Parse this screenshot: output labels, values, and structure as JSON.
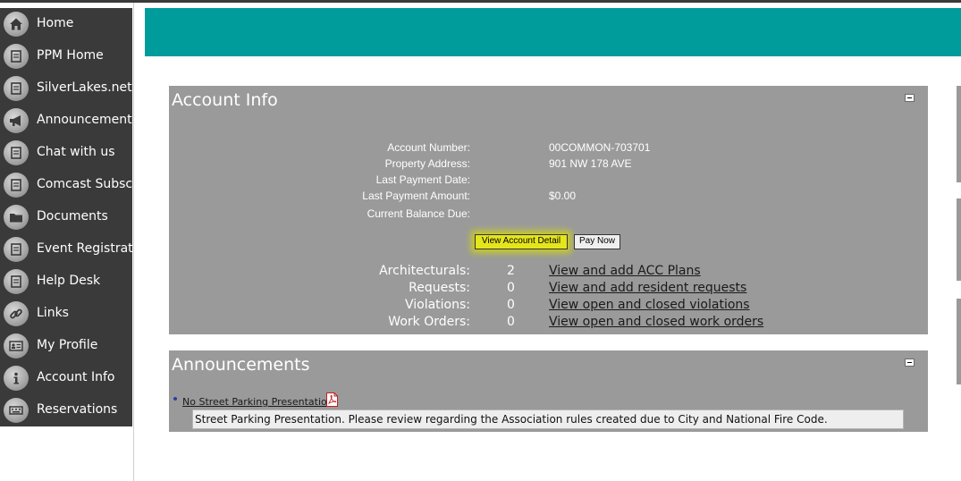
{
  "sidebar": {
    "items": [
      {
        "label": "Home",
        "icon": "home-icon"
      },
      {
        "label": "PPM Home",
        "icon": "page-icon"
      },
      {
        "label": "SilverLakes.net",
        "icon": "page-icon"
      },
      {
        "label": "Announcements",
        "icon": "megaphone-icon"
      },
      {
        "label": "Chat with us",
        "icon": "page-icon"
      },
      {
        "label": "Comcast Subscri",
        "icon": "page-icon"
      },
      {
        "label": "Documents",
        "icon": "folder-icon"
      },
      {
        "label": "Event Registratic",
        "icon": "page-icon"
      },
      {
        "label": "Help Desk",
        "icon": "page-icon"
      },
      {
        "label": "Links",
        "icon": "link-icon"
      },
      {
        "label": "My Profile",
        "icon": "profile-card-icon"
      },
      {
        "label": "Account Info",
        "icon": "info-icon"
      },
      {
        "label": "Reservations",
        "icon": "keyboard-icon"
      }
    ]
  },
  "account_info": {
    "title": "Account Info",
    "fields": [
      {
        "label": "Account Number:",
        "value": "00COMMON-703701"
      },
      {
        "label": "Property Address:",
        "value": "901 NW 178 AVE"
      },
      {
        "label": "Last Payment Date:",
        "value": ""
      },
      {
        "label": "Last Payment Amount:",
        "value": "$0.00"
      },
      {
        "label": "Current Balance Due:",
        "value": ""
      }
    ],
    "view_detail_label": "View Account Detail",
    "pay_now_label": "Pay Now",
    "stats": [
      {
        "label": "Architecturals:",
        "count": "2",
        "link": "View and add ACC Plans"
      },
      {
        "label": "Requests:",
        "count": "0",
        "link": "View and add resident requests"
      },
      {
        "label": "Violations:",
        "count": "0",
        "link": "View open and closed violations"
      },
      {
        "label": "Work Orders:",
        "count": "0",
        "link": "View open and closed work orders"
      }
    ]
  },
  "announcements": {
    "title": "Announcements",
    "items": [
      {
        "title": "No Street Parking Presentation",
        "description": "Street Parking Presentation. Please review regarding the Association rules created due to City and National Fire Code.",
        "attachment_icon": "pdf-icon"
      }
    ]
  },
  "colors": {
    "sidebar_bg": "#3a3a3a",
    "banner": "#009b9b",
    "panel_bg": "#9a9a9a",
    "highlight": "#e5e51c"
  }
}
